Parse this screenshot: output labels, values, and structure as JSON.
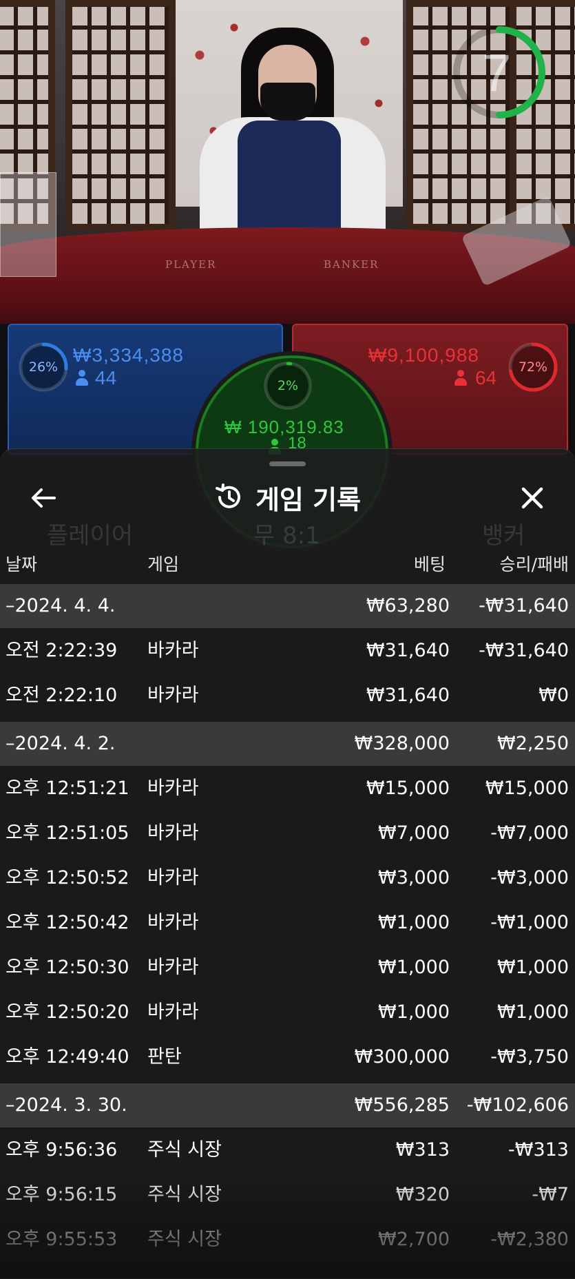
{
  "timer": {
    "value": "7"
  },
  "table": {
    "player_label": "PLAYER",
    "banker_label": "BANKER"
  },
  "bets": {
    "player": {
      "percent": "26%",
      "amount": "₩3,334,388",
      "count": "44",
      "fill": 0.26,
      "color": "#2f7de0"
    },
    "tie": {
      "percent": "2%",
      "amount": "₩ 190,319.83",
      "count": "18",
      "fill": 0.02,
      "color": "#27b83a"
    },
    "banker": {
      "percent": "72%",
      "amount": "₩9,100,988",
      "count": "64",
      "fill": 0.72,
      "color": "#e0282e"
    }
  },
  "history": {
    "title": "게임 기록",
    "icons": {
      "back": "arrow-left-icon",
      "title": "history-icon",
      "close": "close-icon"
    },
    "columns": {
      "date": "날짜",
      "game": "게임",
      "bet": "베팅",
      "result": "승리/패배"
    },
    "groups": [
      {
        "date": "–2024. 4. 4.",
        "bet": "₩63,280",
        "result": "-₩31,640",
        "rows": [
          {
            "time": "오전 2:22:39",
            "game": "바카라",
            "bet": "₩31,640",
            "result": "-₩31,640"
          },
          {
            "time": "오전 2:22:10",
            "game": "바카라",
            "bet": "₩31,640",
            "result": "₩0"
          }
        ]
      },
      {
        "date": "–2024. 4. 2.",
        "bet": "₩328,000",
        "result": "₩2,250",
        "rows": [
          {
            "time": "오후 12:51:21",
            "game": "바카라",
            "bet": "₩15,000",
            "result": "₩15,000"
          },
          {
            "time": "오후 12:51:05",
            "game": "바카라",
            "bet": "₩7,000",
            "result": "-₩7,000"
          },
          {
            "time": "오후 12:50:52",
            "game": "바카라",
            "bet": "₩3,000",
            "result": "-₩3,000"
          },
          {
            "time": "오후 12:50:42",
            "game": "바카라",
            "bet": "₩1,000",
            "result": "-₩1,000"
          },
          {
            "time": "오후 12:50:30",
            "game": "바카라",
            "bet": "₩1,000",
            "result": "₩1,000"
          },
          {
            "time": "오후 12:50:20",
            "game": "바카라",
            "bet": "₩1,000",
            "result": "₩1,000"
          },
          {
            "time": "오후 12:49:40",
            "game": "판탄",
            "bet": "₩300,000",
            "result": "-₩3,750"
          }
        ]
      },
      {
        "date": "–2024. 3. 30.",
        "bet": "₩556,285",
        "result": "-₩102,606",
        "rows": [
          {
            "time": "오후 9:56:36",
            "game": "주식 시장",
            "bet": "₩313",
            "result": "-₩313"
          },
          {
            "time": "오후 9:56:15",
            "game": "주식 시장",
            "bet": "₩320",
            "result": "-₩7"
          },
          {
            "time": "오후 9:55:53",
            "game": "주식 시장",
            "bet": "₩2,700",
            "result": "-₩2,380"
          }
        ]
      }
    ]
  },
  "background": {
    "player_label": "플레이어",
    "tie_label": "무 8:1",
    "banker_label": "뱅커"
  }
}
